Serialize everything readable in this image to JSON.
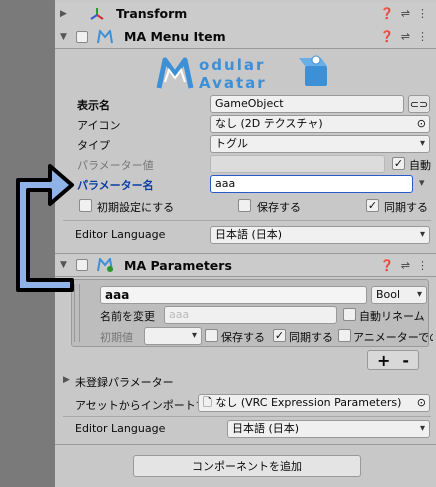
{
  "components": {
    "transform": {
      "title": "Transform"
    },
    "menu_item": {
      "title": "MA Menu Item",
      "logo_text": "Modular Avatar",
      "name_label": "表示名",
      "name_value": "GameObject",
      "icon_label": "アイコン",
      "icon_value": "なし (2D テクスチャ)",
      "type_label": "タイプ",
      "type_value": "トグル",
      "param_value_label": "パラメーター値",
      "auto_label": "自動",
      "param_name_label": "パラメーター名",
      "param_name_value": "aaa",
      "default_label": "初期設定にする",
      "saved_label": "保存する",
      "synced_label": "同期する",
      "editor_language_label": "Editor Language",
      "editor_language_value": "日本語 (日本)"
    },
    "parameters": {
      "title": "MA Parameters",
      "param_name": "aaa",
      "param_type": "Bool",
      "rename_label": "名前を変更",
      "rename_placeholder": "aaa",
      "auto_rename_label": "自動リネーム",
      "default_value_label": "初期値",
      "saved_label": "保存する",
      "synced_label": "同期する",
      "animator_label": "アニメーターでの名",
      "add_btn": "+",
      "remove_btn": "-",
      "unregistered_label": "未登録パラメーター",
      "import_label": "アセットからインポートする",
      "import_value": "なし (VRC Expression Parameters)",
      "editor_language_label": "Editor Language",
      "editor_language_value": "日本語 (日本)"
    },
    "add_component": "コンポーネントを追加"
  },
  "colors": {
    "accent_blue": "#3d8fd6",
    "arrow_blue": "#8fb3e6",
    "highlight": "#0a3ea6"
  }
}
